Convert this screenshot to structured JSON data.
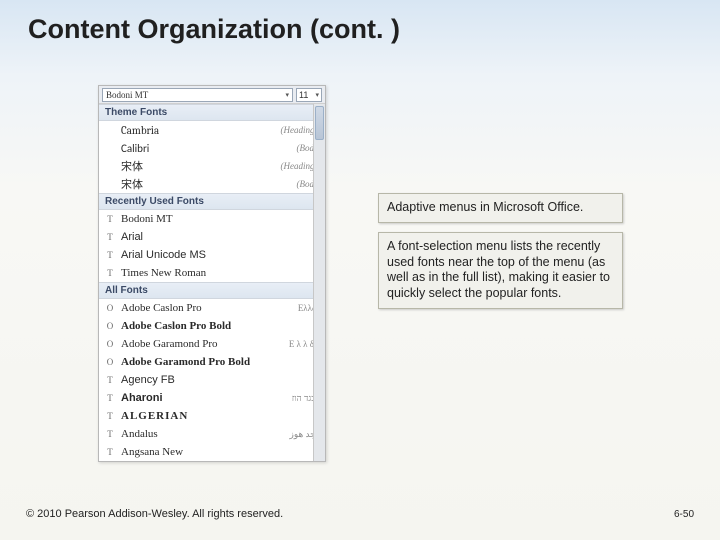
{
  "title": "Content Organization (cont. )",
  "ribbon": {
    "font_name": "Bodoni MT",
    "font_size": "11"
  },
  "sections": {
    "theme_fonts": "Theme Fonts",
    "recent_fonts": "Recently Used Fonts",
    "all_fonts": "All Fonts"
  },
  "theme_fonts": [
    {
      "name": "Cambria",
      "hint": "(Headings)",
      "css": "ff-cambria"
    },
    {
      "name": "Calibri",
      "hint": "(Body)",
      "css": "ff-calibri"
    },
    {
      "name": "宋体",
      "hint": "(Headings)",
      "css": "ff-cjk"
    },
    {
      "name": "宋体",
      "hint": "(Body)",
      "css": "ff-cjk"
    }
  ],
  "recent_fonts": [
    {
      "name": "Bodoni MT",
      "glyph": "T",
      "css": "ff-bodoni"
    },
    {
      "name": "Arial",
      "glyph": "T",
      "css": "ff-arial"
    },
    {
      "name": "Arial Unicode MS",
      "glyph": "T",
      "css": "ff-arialu"
    },
    {
      "name": "Times New Roman",
      "glyph": "T",
      "css": "ff-tnr"
    }
  ],
  "all_fonts": [
    {
      "name": "Adobe Caslon Pro",
      "glyph": "O",
      "sample": "Ελλδα",
      "css": "ff-caslon"
    },
    {
      "name": "Adobe Caslon Pro Bold",
      "glyph": "O",
      "sample": "",
      "css": "ff-caslon",
      "bold": true
    },
    {
      "name": "Adobe Garamond Pro",
      "glyph": "O",
      "sample": "Ε λ λ  δ α",
      "css": "ff-garamond"
    },
    {
      "name": "Adobe Garamond Pro Bold",
      "glyph": "O",
      "sample": "",
      "css": "ff-garamond",
      "bold": true
    },
    {
      "name": "Agency FB",
      "glyph": "T",
      "sample": "",
      "css": "ff-agency"
    },
    {
      "name": "Aharoni",
      "glyph": "T",
      "sample": "אבגד הוז",
      "css": "ff-aharoni"
    },
    {
      "name": "ALGERIAN",
      "glyph": "T",
      "sample": "",
      "css": "ff-algerian"
    },
    {
      "name": "Andalus",
      "glyph": "T",
      "sample": "أبجد هوز",
      "css": "ff-andalus"
    },
    {
      "name": "Angsana New",
      "glyph": "T",
      "sample": "",
      "css": "ff-angsana"
    }
  ],
  "callout": {
    "line1": "Adaptive menus in Microsoft Office.",
    "line2": "A font-selection menu lists the recently used fonts near the top of the menu (as well as in the full list), making it easier to quickly select the popular fonts."
  },
  "footer": {
    "copyright": "© 2010 Pearson Addison-Wesley. All rights reserved.",
    "page": "6-50"
  }
}
